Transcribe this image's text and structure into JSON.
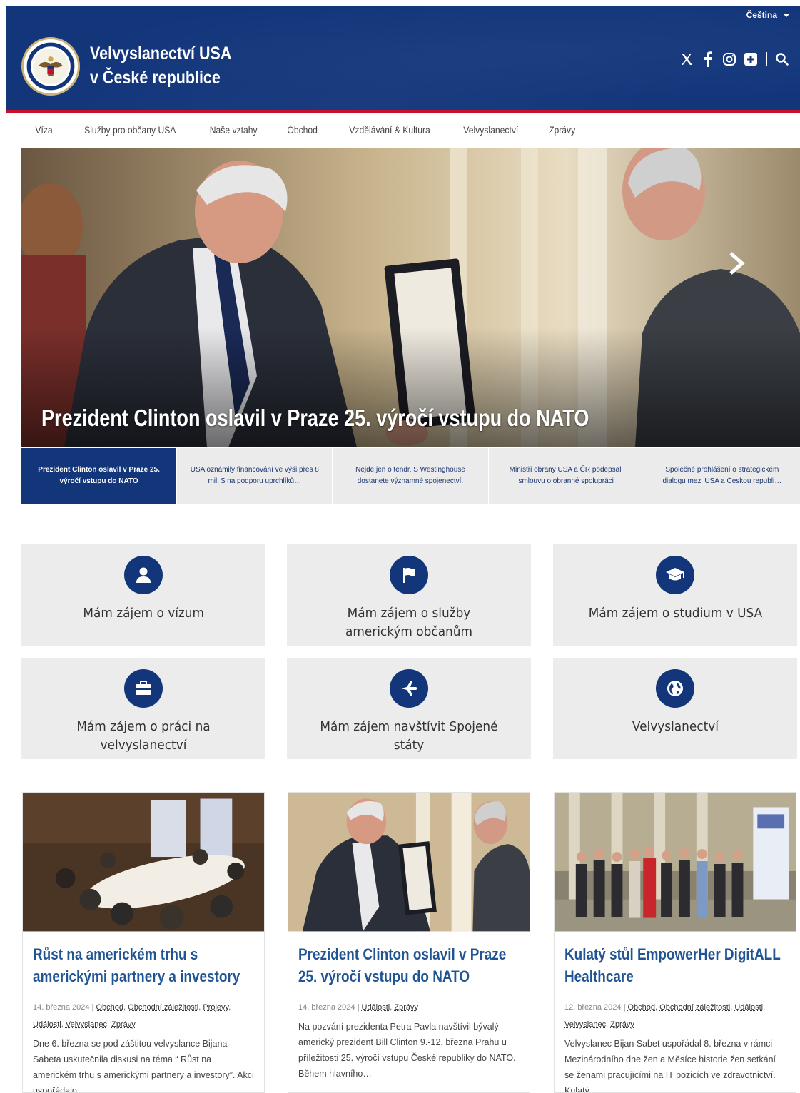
{
  "header": {
    "language": "Čeština",
    "title_line1": "Velvyslanectví USA",
    "title_line2": "v České republice",
    "social": [
      "x-icon",
      "facebook-icon",
      "instagram-icon",
      "flickr-icon"
    ],
    "search_icon": "search-icon"
  },
  "nav": {
    "items": [
      "Víza",
      "Služby pro občany USA",
      "Naše vztahy",
      "Obchod",
      "Vzdělávání & Kultura",
      "Velvyslanectví",
      "Zprávy"
    ]
  },
  "hero": {
    "caption": "Prezident Clinton oslavil v Praze 25. výročí vstupu do NATO"
  },
  "carousel_tabs": [
    "Prezident Clinton oslavil v Praze 25. výročí vstupu do NATO",
    "USA oznámily financování ve výši přes 8 mil. $ na podporu uprchlíků…",
    "Nejde jen o tendr. S Westinghouse dostanete významné spojenectví.",
    "Ministři obrany USA a ČR podepsali smlouvu o obranné spolupráci",
    "Společné prohlášení o strategickém dialogu mezi USA a Českou republi…"
  ],
  "services": [
    {
      "label": "Mám zájem o vízum",
      "icon": "user-icon"
    },
    {
      "label": "Mám zájem o služby americkým občanům",
      "icon": "flag-icon"
    },
    {
      "label": "Mám zájem o studium v USA",
      "icon": "graduation-cap-icon"
    },
    {
      "label": "Mám zájem o práci na velvyslanectví",
      "icon": "briefcase-icon"
    },
    {
      "label": "Mám zájem navštívit Spojené státy",
      "icon": "plane-icon"
    },
    {
      "label": "Velvyslanectví",
      "icon": "globe-icon"
    }
  ],
  "cards": [
    {
      "title": "Růst na americkém trhu s americkými partnery a investory",
      "date": "14. března 2024",
      "tags": [
        "Obchod",
        "Obchodní záležitosti",
        "Projevy",
        "Události",
        "Velvyslanec",
        "Zprávy"
      ],
      "excerpt": "Dne 6. března se pod záštitou velvyslance Bijana Sabeta uskutečnila diskusi na téma “ Růst na americkém trhu s americkými partnery a investory”. Akci uspořádalo…"
    },
    {
      "title": "Prezident Clinton oslavil v Praze 25. výročí vstupu do NATO",
      "date": "14. března 2024",
      "tags": [
        "Události",
        "Zprávy"
      ],
      "excerpt": "Na pozvání prezidenta Petra Pavla navštívil bývalý americký prezident Bill Clinton 9.-12. března Prahu u příležitosti 25. výročí vstupu České republiky do NATO. Během hlavního…"
    },
    {
      "title": "Kulatý stůl EmpowerHer DigitALL Healthcare",
      "date": "12. března 2024",
      "tags": [
        "Obchod",
        "Obchodní záležitosti",
        "Události",
        "Velvyslanec",
        "Zprávy"
      ],
      "excerpt": "Velvyslanec Bijan Sabet uspořádal 8. března v rámci Mezinárodního dne žen a Měsíce historie žen setkání se ženami pracujícími na IT pozicích ve zdravotnictví. Kulatý…"
    }
  ],
  "colors": {
    "brand_blue": "#13367b",
    "accent_red": "#c8102e",
    "link_blue": "#205493",
    "tile_gray": "#ececec"
  }
}
